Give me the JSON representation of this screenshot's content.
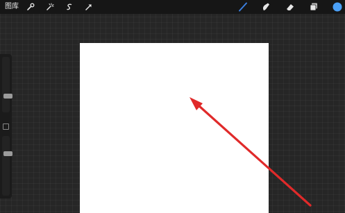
{
  "topbar": {
    "gallery_label": "图库"
  },
  "toolbar_icons": {
    "left": [
      "wrench-icon",
      "magic-wand-icon",
      "selection-icon",
      "transform-arrow-icon"
    ],
    "right": [
      "brush-icon",
      "smudge-icon",
      "eraser-icon",
      "layers-icon",
      "color-picker-icon"
    ]
  },
  "sidebar": {
    "brush_size": 0.27,
    "brush_opacity": 0.72
  },
  "annotation": {
    "arrow_color": "#e02a2a"
  },
  "colors": {
    "active_tool": "#3b7fe0",
    "current_color": "#4a9ff5"
  }
}
